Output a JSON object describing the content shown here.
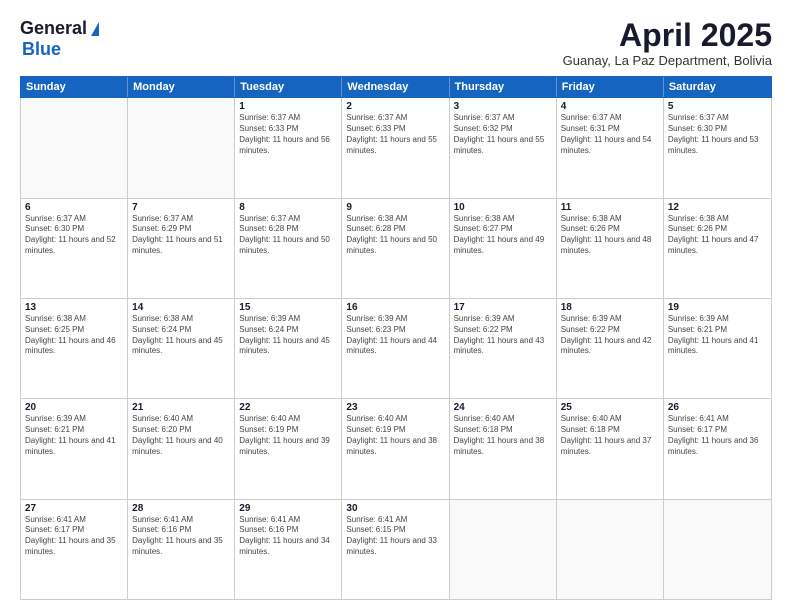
{
  "logo": {
    "general": "General",
    "blue": "Blue"
  },
  "title": "April 2025",
  "location": "Guanay, La Paz Department, Bolivia",
  "weekdays": [
    "Sunday",
    "Monday",
    "Tuesday",
    "Wednesday",
    "Thursday",
    "Friday",
    "Saturday"
  ],
  "weeks": [
    [
      {
        "day": "",
        "empty": true
      },
      {
        "day": "",
        "empty": true
      },
      {
        "day": "1",
        "sunrise": "Sunrise: 6:37 AM",
        "sunset": "Sunset: 6:33 PM",
        "daylight": "Daylight: 11 hours and 56 minutes."
      },
      {
        "day": "2",
        "sunrise": "Sunrise: 6:37 AM",
        "sunset": "Sunset: 6:33 PM",
        "daylight": "Daylight: 11 hours and 55 minutes."
      },
      {
        "day": "3",
        "sunrise": "Sunrise: 6:37 AM",
        "sunset": "Sunset: 6:32 PM",
        "daylight": "Daylight: 11 hours and 55 minutes."
      },
      {
        "day": "4",
        "sunrise": "Sunrise: 6:37 AM",
        "sunset": "Sunset: 6:31 PM",
        "daylight": "Daylight: 11 hours and 54 minutes."
      },
      {
        "day": "5",
        "sunrise": "Sunrise: 6:37 AM",
        "sunset": "Sunset: 6:30 PM",
        "daylight": "Daylight: 11 hours and 53 minutes."
      }
    ],
    [
      {
        "day": "6",
        "sunrise": "Sunrise: 6:37 AM",
        "sunset": "Sunset: 6:30 PM",
        "daylight": "Daylight: 11 hours and 52 minutes."
      },
      {
        "day": "7",
        "sunrise": "Sunrise: 6:37 AM",
        "sunset": "Sunset: 6:29 PM",
        "daylight": "Daylight: 11 hours and 51 minutes."
      },
      {
        "day": "8",
        "sunrise": "Sunrise: 6:37 AM",
        "sunset": "Sunset: 6:28 PM",
        "daylight": "Daylight: 11 hours and 50 minutes."
      },
      {
        "day": "9",
        "sunrise": "Sunrise: 6:38 AM",
        "sunset": "Sunset: 6:28 PM",
        "daylight": "Daylight: 11 hours and 50 minutes."
      },
      {
        "day": "10",
        "sunrise": "Sunrise: 6:38 AM",
        "sunset": "Sunset: 6:27 PM",
        "daylight": "Daylight: 11 hours and 49 minutes."
      },
      {
        "day": "11",
        "sunrise": "Sunrise: 6:38 AM",
        "sunset": "Sunset: 6:26 PM",
        "daylight": "Daylight: 11 hours and 48 minutes."
      },
      {
        "day": "12",
        "sunrise": "Sunrise: 6:38 AM",
        "sunset": "Sunset: 6:26 PM",
        "daylight": "Daylight: 11 hours and 47 minutes."
      }
    ],
    [
      {
        "day": "13",
        "sunrise": "Sunrise: 6:38 AM",
        "sunset": "Sunset: 6:25 PM",
        "daylight": "Daylight: 11 hours and 46 minutes."
      },
      {
        "day": "14",
        "sunrise": "Sunrise: 6:38 AM",
        "sunset": "Sunset: 6:24 PM",
        "daylight": "Daylight: 11 hours and 45 minutes."
      },
      {
        "day": "15",
        "sunrise": "Sunrise: 6:39 AM",
        "sunset": "Sunset: 6:24 PM",
        "daylight": "Daylight: 11 hours and 45 minutes."
      },
      {
        "day": "16",
        "sunrise": "Sunrise: 6:39 AM",
        "sunset": "Sunset: 6:23 PM",
        "daylight": "Daylight: 11 hours and 44 minutes."
      },
      {
        "day": "17",
        "sunrise": "Sunrise: 6:39 AM",
        "sunset": "Sunset: 6:22 PM",
        "daylight": "Daylight: 11 hours and 43 minutes."
      },
      {
        "day": "18",
        "sunrise": "Sunrise: 6:39 AM",
        "sunset": "Sunset: 6:22 PM",
        "daylight": "Daylight: 11 hours and 42 minutes."
      },
      {
        "day": "19",
        "sunrise": "Sunrise: 6:39 AM",
        "sunset": "Sunset: 6:21 PM",
        "daylight": "Daylight: 11 hours and 41 minutes."
      }
    ],
    [
      {
        "day": "20",
        "sunrise": "Sunrise: 6:39 AM",
        "sunset": "Sunset: 6:21 PM",
        "daylight": "Daylight: 11 hours and 41 minutes."
      },
      {
        "day": "21",
        "sunrise": "Sunrise: 6:40 AM",
        "sunset": "Sunset: 6:20 PM",
        "daylight": "Daylight: 11 hours and 40 minutes."
      },
      {
        "day": "22",
        "sunrise": "Sunrise: 6:40 AM",
        "sunset": "Sunset: 6:19 PM",
        "daylight": "Daylight: 11 hours and 39 minutes."
      },
      {
        "day": "23",
        "sunrise": "Sunrise: 6:40 AM",
        "sunset": "Sunset: 6:19 PM",
        "daylight": "Daylight: 11 hours and 38 minutes."
      },
      {
        "day": "24",
        "sunrise": "Sunrise: 6:40 AM",
        "sunset": "Sunset: 6:18 PM",
        "daylight": "Daylight: 11 hours and 38 minutes."
      },
      {
        "day": "25",
        "sunrise": "Sunrise: 6:40 AM",
        "sunset": "Sunset: 6:18 PM",
        "daylight": "Daylight: 11 hours and 37 minutes."
      },
      {
        "day": "26",
        "sunrise": "Sunrise: 6:41 AM",
        "sunset": "Sunset: 6:17 PM",
        "daylight": "Daylight: 11 hours and 36 minutes."
      }
    ],
    [
      {
        "day": "27",
        "sunrise": "Sunrise: 6:41 AM",
        "sunset": "Sunset: 6:17 PM",
        "daylight": "Daylight: 11 hours and 35 minutes."
      },
      {
        "day": "28",
        "sunrise": "Sunrise: 6:41 AM",
        "sunset": "Sunset: 6:16 PM",
        "daylight": "Daylight: 11 hours and 35 minutes."
      },
      {
        "day": "29",
        "sunrise": "Sunrise: 6:41 AM",
        "sunset": "Sunset: 6:16 PM",
        "daylight": "Daylight: 11 hours and 34 minutes."
      },
      {
        "day": "30",
        "sunrise": "Sunrise: 6:41 AM",
        "sunset": "Sunset: 6:15 PM",
        "daylight": "Daylight: 11 hours and 33 minutes."
      },
      {
        "day": "",
        "empty": true
      },
      {
        "day": "",
        "empty": true
      },
      {
        "day": "",
        "empty": true
      }
    ]
  ]
}
